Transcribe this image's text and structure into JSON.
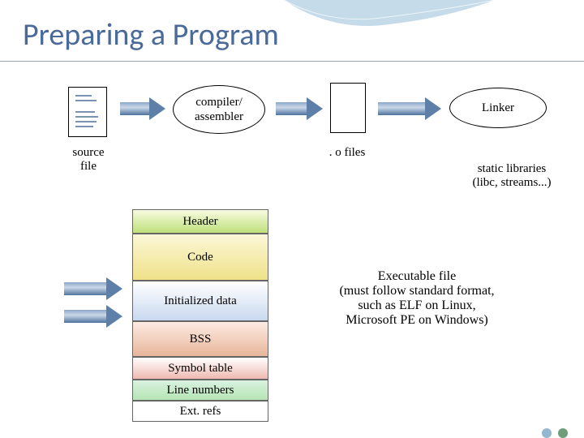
{
  "title": "Preparing a Program",
  "source_label": "source\nfile",
  "compiler_label": "compiler/\nassembler",
  "ofiles_label": ". o files",
  "linker_label": "Linker",
  "static_libs_label": "static libraries\n(libc, streams...)",
  "exec_label": "Executable file\n(must follow standard format,\nsuch as ELF on Linux,\nMicrosoft PE on Windows)",
  "stack": {
    "header": "Header",
    "code": "Code",
    "initialized": "Initialized data",
    "bss": "BSS",
    "symbol": "Symbol table",
    "line": "Line numbers",
    "ext": "Ext. refs"
  }
}
